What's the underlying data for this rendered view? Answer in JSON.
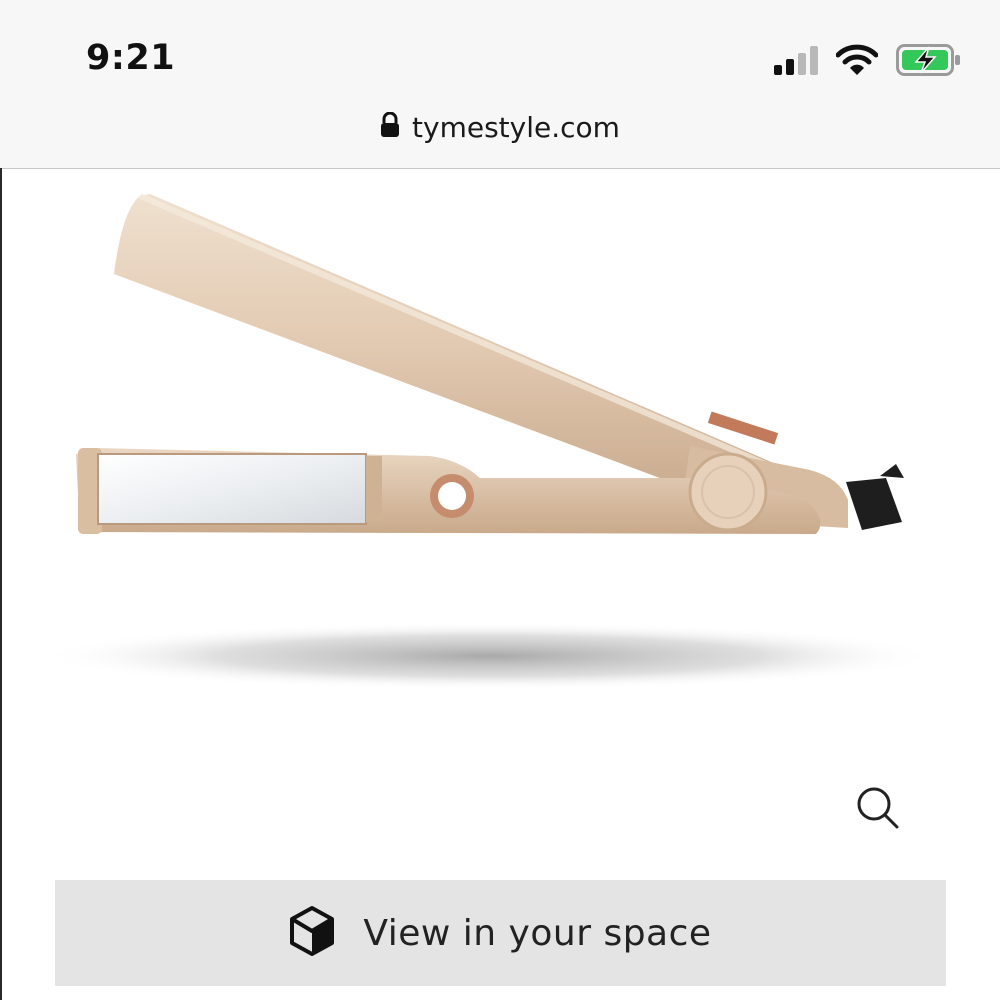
{
  "status_bar": {
    "time": "9:21",
    "signal_icon": "cellular-signal-icon",
    "wifi_icon": "wifi-icon",
    "battery_icon": "battery-charging-icon",
    "battery_color": "#34c759"
  },
  "browser": {
    "lock_icon": "lock-icon",
    "url": "tymestyle.com"
  },
  "product": {
    "image_icon": "hair-straightener-image",
    "zoom_icon": "search-icon"
  },
  "actions": {
    "ar_icon": "cube-icon",
    "ar_label": "View in your space"
  }
}
